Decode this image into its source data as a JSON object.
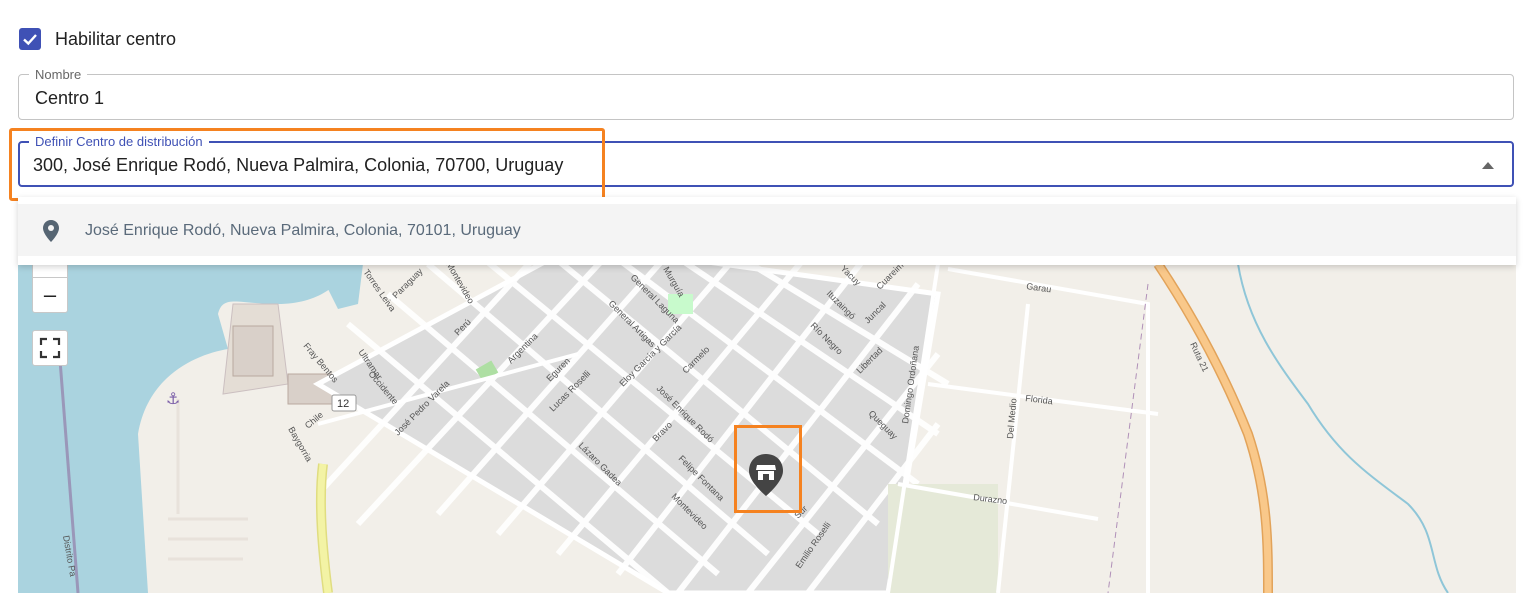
{
  "enable_center": {
    "label": "Habilitar centro",
    "checked": true
  },
  "name_field": {
    "label": "Nombre",
    "value": "Centro 1"
  },
  "distribution_field": {
    "label": "Definir Centro de distribución",
    "value": "300, José Enrique Rodó, Nueva Palmira, Colonia, 70700, Uruguay"
  },
  "suggestions": [
    {
      "text": "José Enrique Rodó, Nueva Palmira, Colonia, 70101, Uruguay",
      "icon": "location-pin-icon"
    }
  ],
  "map": {
    "zoom_out_label": "–",
    "route_shield": "12",
    "street_labels": [
      "Garau",
      "Ruta 21",
      "Florida",
      "Durazno",
      "Del Medio",
      "Domingo Ordoñana",
      "Queguay",
      "Libertad",
      "Juncal",
      "Río Negro",
      "Ituzaingó",
      "Cuareim",
      "Yacuy",
      "Sur",
      "Emilio Roselli",
      "Felipe Fontana",
      "Montevideo",
      "Lázaro Gadea",
      "Lucas Roselli",
      "Bravo",
      "José Enrique Rodó",
      "Eloy García y García",
      "Carmelo",
      "General Artigas",
      "General Laguna",
      "Eguren",
      "Argentina",
      "Perú",
      "Paraguay",
      "Torres Leiva",
      "Fray Bentos",
      "Ultramar",
      "Occidente",
      "José Pedro Varela",
      "Chile",
      "Baygorria",
      "Distrito Pa",
      "Murguía",
      "Montevideo"
    ],
    "colors": {
      "land": "#f2efe9",
      "water": "#aad3df",
      "block": "#dddddd",
      "route": "#f9b15a",
      "highlight": "#f58220"
    }
  }
}
